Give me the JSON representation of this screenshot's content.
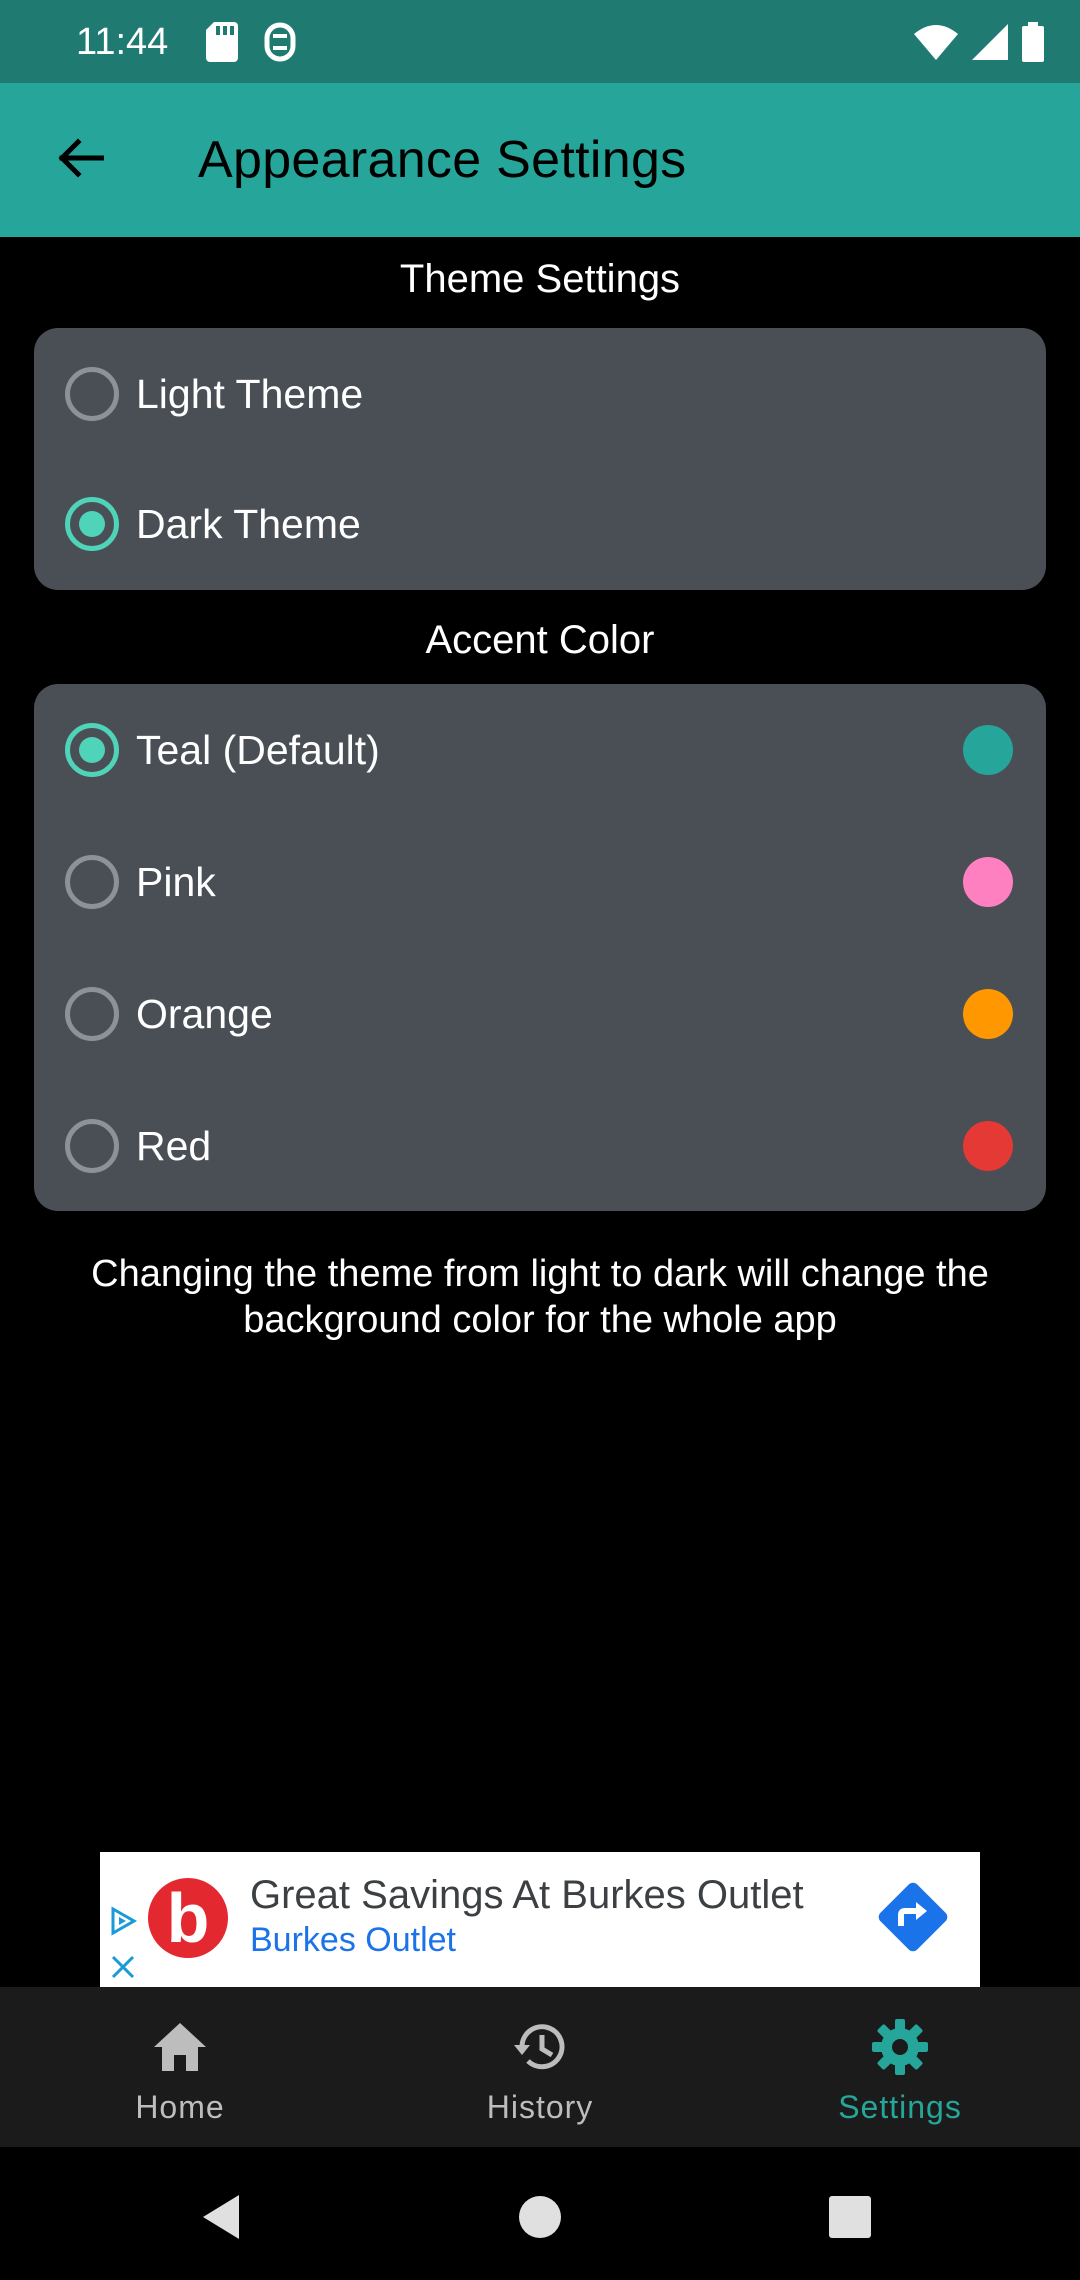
{
  "status_bar": {
    "time": "11:44",
    "icons": [
      "sd-card-icon",
      "sync-icon",
      "wifi-icon",
      "signal-icon",
      "battery-icon"
    ]
  },
  "app_bar": {
    "title": "Appearance Settings",
    "back_icon": "arrow-back-icon",
    "background": "#26a69a"
  },
  "theme_section": {
    "heading": "Theme Settings",
    "options": [
      {
        "label": "Light Theme",
        "selected": false
      },
      {
        "label": "Dark Theme",
        "selected": true
      }
    ]
  },
  "accent_section": {
    "heading": "Accent Color",
    "options": [
      {
        "label": "Teal (Default)",
        "selected": true,
        "color": "#26a69a"
      },
      {
        "label": "Pink",
        "selected": false,
        "color": "#ff80c0"
      },
      {
        "label": "Orange",
        "selected": false,
        "color": "#ff9800"
      },
      {
        "label": "Red",
        "selected": false,
        "color": "#e53935"
      }
    ]
  },
  "info_text": "Changing the theme from light to dark will change the background color for the whole app",
  "ad": {
    "title": "Great Savings At Burkes Outlet",
    "advertiser": "Burkes Outlet",
    "logo_letter": "b",
    "logo_color": "#e3282f",
    "cta_icon": "directions-icon"
  },
  "bottom_nav": {
    "items": [
      {
        "label": "Home",
        "icon": "home-icon",
        "active": false
      },
      {
        "label": "History",
        "icon": "history-icon",
        "active": false
      },
      {
        "label": "Settings",
        "icon": "gear-icon",
        "active": true
      }
    ],
    "active_color": "#26a69a"
  },
  "system_nav": [
    "back-triangle-icon",
    "home-circle-icon",
    "recents-square-icon"
  ]
}
